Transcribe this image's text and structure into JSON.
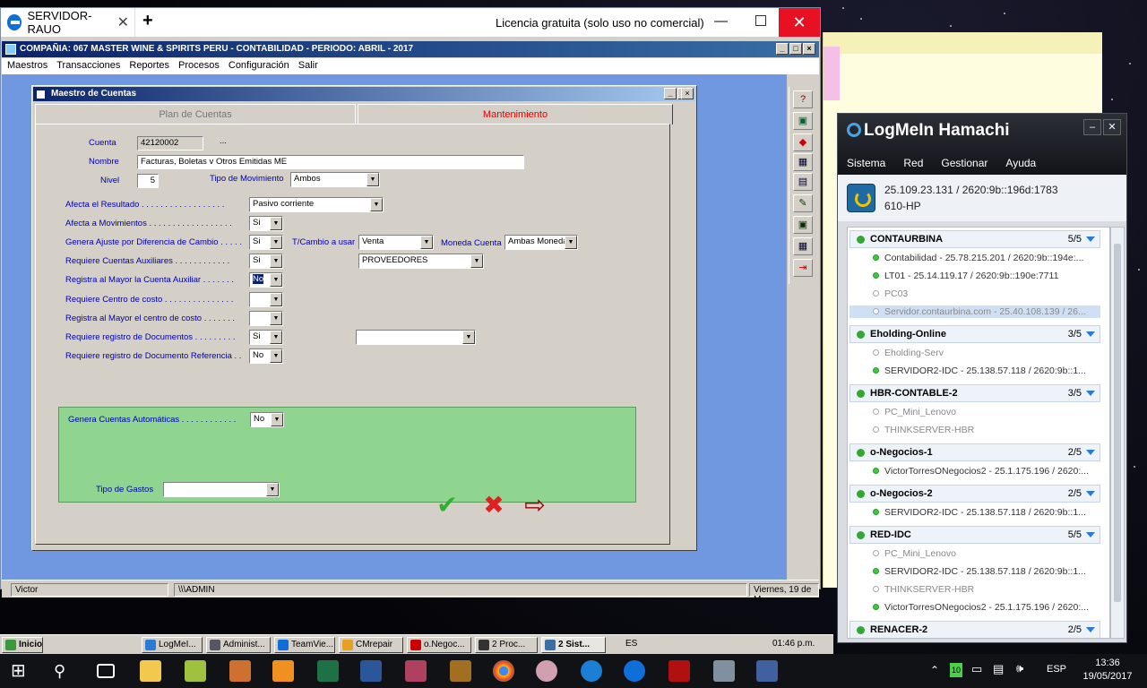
{
  "teamviewer": {
    "tab_title": "SERVIDOR-RAUO",
    "license_text": "Licencia gratuita (solo uso no comercial)"
  },
  "app": {
    "title": "COMPAÑIA: 067 MASTER WINE & SPIRITS PERU    -    CONTABILIDAD    -    PERIODO: ABRIL - 2017",
    "menu": [
      "Maestros",
      "Transacciones",
      "Reportes",
      "Procesos",
      "Configuración",
      "Salir"
    ],
    "status": {
      "user": "Victor",
      "admin": "\\\\\\ADMIN",
      "date": "Viernes, 19 de M"
    }
  },
  "dialog": {
    "title": "Maestro de Cuentas",
    "tabs": [
      "Plan de Cuentas",
      "Mantenimiento"
    ],
    "labels": {
      "cuenta": "Cuenta",
      "nombre": "Nombre",
      "nivel": "Nivel",
      "tipo_mov": "Tipo de Movimiento",
      "afecta_resultado": "Afecta el  Resultado . . . . . . . . . . . . . . . . . .",
      "afecta_mov": "Afecta a Movimientos . . . . . . . . . . . . . . . . . .",
      "genera_ajuste": "Genera Ajuste por Diferencia de Cambio . . . . .",
      "tcambio": "T/Cambio a usar",
      "moneda": "Moneda Cuenta",
      "req_aux": "Requiere Cuentas Auxiliares . . . . . . . . . . . .",
      "reg_aux": "Registra al Mayor la Cuenta Auxiliar . . . . . . .",
      "req_cc": "Requiere Centro de costo . . . . . . . . . . . . . . .",
      "reg_cc": "Registra al Mayor el centro de costo . . . . . . .",
      "req_docs": "Requiere registro de Documentos . . . . . . . . .",
      "req_ref": "Requiere registro de Documento Referencia . .",
      "genera_auto": "Genera Cuentas Automáticas . . . . . . . . . . . .",
      "tipo_gastos": "Tipo de Gastos"
    },
    "values": {
      "cuenta": "42120002",
      "ellipsis": "...",
      "nombre": "Facturas, Boletas v Otros Emitidas ME",
      "nivel": "5",
      "tipo_mov": "Ambos",
      "afecta_resultado": "Pasivo corriente",
      "afecta_mov": "Si",
      "genera_ajuste": "Si",
      "tcambio": "Venta",
      "moneda": "Ambas Moneda",
      "req_aux": "Si",
      "aux_tipo": "PROVEEDORES",
      "reg_aux": "No",
      "req_cc": "",
      "reg_cc": "",
      "req_docs": "Si",
      "doc_tipo": "",
      "req_ref": "No",
      "genera_auto": "No",
      "tipo_gastos": ""
    }
  },
  "hamachi": {
    "title": "LogMeIn Hamachi",
    "menu": [
      "Sistema",
      "Red",
      "Gestionar",
      "Ayuda"
    ],
    "ip": "25.109.23.131 / 2620:9b::196d:1783",
    "host": "610-HP",
    "networks": [
      {
        "name": "CONTAURBINA",
        "count": "5/5",
        "peers": [
          {
            "label": "Contabilidad - 25.78.215.201 / 2620:9b::194e:...",
            "online": true
          },
          {
            "label": "LT01 - 25.14.119.17 / 2620:9b::190e:7711",
            "online": true
          },
          {
            "label": "PC03",
            "online": false
          },
          {
            "label": "Servidor.contaurbina.com - 25.40.108.139 / 26...",
            "online": false
          }
        ]
      },
      {
        "name": "Eholding-Online",
        "count": "3/5",
        "peers": [
          {
            "label": "Eholding-Serv",
            "online": false
          },
          {
            "label": "SERVIDOR2-IDC - 25.138.57.118 / 2620:9b::1...",
            "online": true
          }
        ]
      },
      {
        "name": "HBR-CONTABLE-2",
        "count": "3/5",
        "peers": [
          {
            "label": "PC_Mini_Lenovo",
            "online": false
          },
          {
            "label": "THINKSERVER-HBR",
            "online": false
          }
        ]
      },
      {
        "name": "o-Negocios-1",
        "count": "2/5",
        "peers": [
          {
            "label": "VictorTorresONegocios2 - 25.1.175.196 / 2620:...",
            "online": true
          }
        ]
      },
      {
        "name": "o-Negocios-2",
        "count": "2/5",
        "peers": [
          {
            "label": "SERVIDOR2-IDC - 25.138.57.118 / 2620:9b::1...",
            "online": true
          }
        ]
      },
      {
        "name": "RED-IDC",
        "count": "5/5",
        "peers": [
          {
            "label": "PC_Mini_Lenovo",
            "online": false
          },
          {
            "label": "SERVIDOR2-IDC - 25.138.57.118 / 2620:9b::1...",
            "online": true
          },
          {
            "label": "THINKSERVER-HBR",
            "online": false
          },
          {
            "label": "VictorTorresONegocios2 - 25.1.175.196 / 2620:...",
            "online": true
          }
        ]
      },
      {
        "name": "RENACER-2",
        "count": "2/5",
        "peers": []
      }
    ]
  },
  "xp_taskbar": {
    "start": "Inicio",
    "items": [
      "LogMeI...",
      "Administ...",
      "TeamVie...",
      "CMrepair",
      "o.Negoc...",
      "2 Proc...",
      "2 Sist..."
    ],
    "lang": "ES",
    "time": "01:46 p.m."
  },
  "win_taskbar": {
    "lang": "ESP",
    "time": "13:36",
    "date": "19/05/2017",
    "notif_count": "10"
  }
}
